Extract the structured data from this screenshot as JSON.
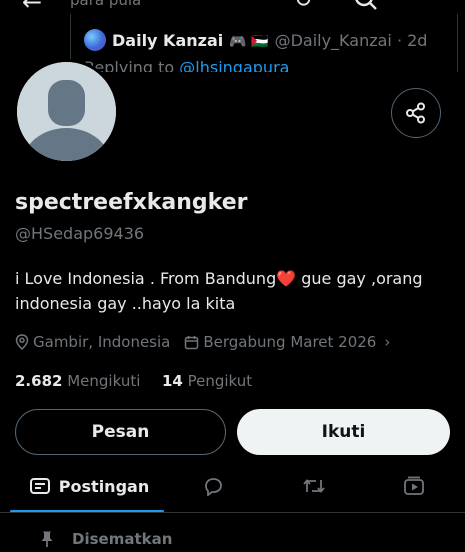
{
  "header": {
    "back_icon": "arrow-left-icon",
    "top_text": "para pula",
    "icons": [
      "refresh-icon",
      "search-icon"
    ]
  },
  "quote": {
    "name": "Daily Kanzai",
    "emojis": "🎮 🇵🇸",
    "handle": "@Daily_Kanzai · 2d",
    "replying_prefix": "Replying to ",
    "replying_handle": "@lhsingapura"
  },
  "profile": {
    "display_name": "spectreefxkangker",
    "handle": "@HSedap69436",
    "bio": "i Love Indonesia . From Bandung❤️ gue gay ,orang indonesia gay ..hayo la kita",
    "location": "Gambir, Indonesia",
    "joined": "Bergabung Maret 2026",
    "following_count": "2.682",
    "following_label": "Mengikuti",
    "followers_count": "14",
    "followers_label": "Pengikut"
  },
  "actions": {
    "message_label": "Pesan",
    "follow_label": "Ikuti",
    "share_icon": "share-icon"
  },
  "tabs": {
    "posts_label": "Postingan",
    "icons": [
      "posts-icon",
      "replies-icon",
      "reposts-icon",
      "media-icon"
    ]
  },
  "pinned": {
    "label": "Disematkan"
  },
  "colors": {
    "background": "#000000",
    "text_primary": "#e7e9ea",
    "text_secondary": "#71767b",
    "accent": "#1d9bf0",
    "border": "#2f3336"
  }
}
